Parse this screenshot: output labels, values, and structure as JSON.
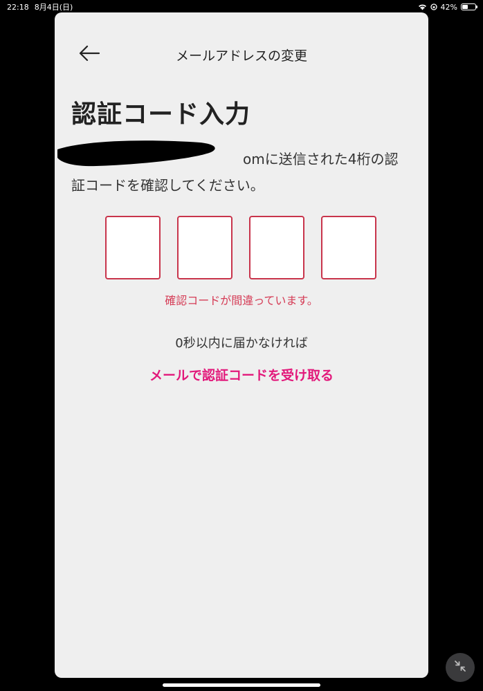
{
  "status_bar": {
    "time": "22:18",
    "date": "8月4日(日)",
    "battery_text": "42%",
    "battery_level": 0.42
  },
  "header": {
    "title": "メールアドレスの変更",
    "back_icon": "arrow-left-icon"
  },
  "page": {
    "heading": "認証コード入力",
    "email_suffix": "om",
    "description_rest": "に送信された4桁の認証コードを確認してください。",
    "code_inputs": [
      "",
      "",
      "",
      ""
    ],
    "error_message": "確認コードが間違っています。",
    "resend_hint": "0秒以内に届かなければ",
    "resend_link": "メールで認証コードを受け取る"
  },
  "colors": {
    "accent": "#e2197b",
    "error": "#d53b55",
    "input_border": "#c8344b"
  }
}
